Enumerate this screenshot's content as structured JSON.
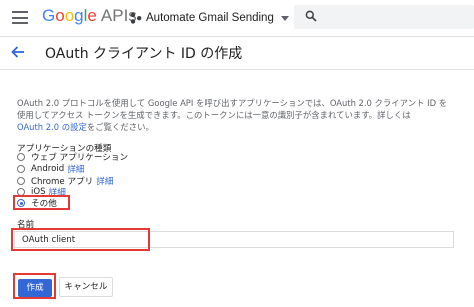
{
  "header": {
    "logo": {
      "g1": "G",
      "g2": "o",
      "g3": "o",
      "g4": "g",
      "g5": "l",
      "g6": "e",
      "product": "APIs"
    },
    "project_name": "Automate Gmail Sending",
    "search_icon": "search-icon",
    "menu_icon": "menu-icon"
  },
  "page": {
    "title": "OAuth クライアント ID の作成",
    "back_icon": "arrow-back-icon"
  },
  "description": {
    "line1": "OAuth 2.0 プロトコルを使用して Google API を呼び出すアプリケーションでは、OAuth 2.0 クライアント ID を",
    "line2": "使用してアクセス トークンを生成できます。このトークンには一意の識別子が含まれています。詳しくは",
    "link": "OAuth 2.0 の設定",
    "line3_suffix": "をご覧ください。"
  },
  "app_type": {
    "label": "アプリケーションの種類",
    "options": [
      {
        "label": "ウェブ アプリケーション",
        "link": "",
        "checked": false
      },
      {
        "label": "Android",
        "link": "詳細",
        "checked": false
      },
      {
        "label": "Chrome アプリ",
        "link": "詳細",
        "checked": false
      },
      {
        "label": "iOS",
        "link": "詳細",
        "checked": false
      },
      {
        "label": "その他",
        "link": "",
        "checked": true
      }
    ]
  },
  "name_field": {
    "label": "名前",
    "value": "OAuth client"
  },
  "actions": {
    "create_label": "作成",
    "cancel_label": "キャンセル"
  },
  "colors": {
    "accent": "#3367d6",
    "highlight": "#e53935",
    "logo_blue": "#4285f4",
    "logo_red": "#ea4335",
    "logo_yellow": "#fbbc05",
    "logo_green": "#34a853"
  }
}
